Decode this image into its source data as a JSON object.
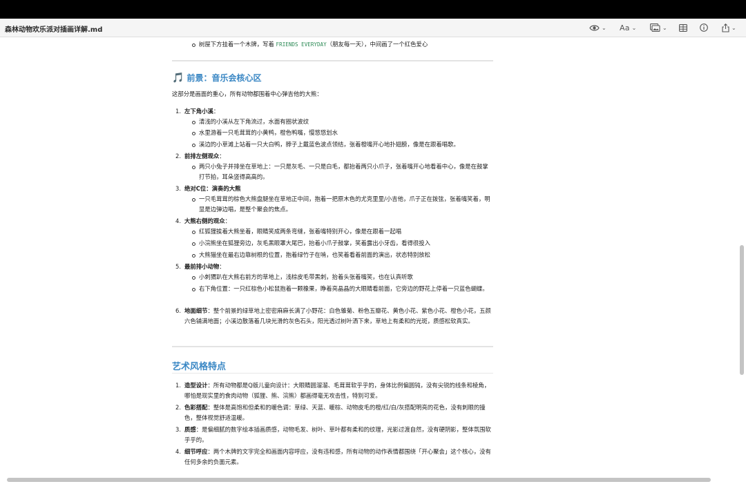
{
  "window": {
    "title": "森林动物欢乐派对插画详解.md",
    "toolbar": {
      "font_label": "Aa"
    }
  },
  "intro_bullet": {
    "pre": "树屋下方挂着一个木牌，写着 ",
    "code": "FRIENDS EVERYDAY",
    "post": "（朋友每一天），中间画了一个红色爱心"
  },
  "foreground": {
    "icon": "🎵",
    "heading": "前景：音乐会核心区",
    "intro": "这部分是画面的重心，所有动物都围着中心弹吉他的大熊：",
    "items": [
      {
        "n": "1.",
        "title": "左下角小溪",
        "colon": "：",
        "subs": [
          "清浅的小溪从左下角流过，水面有圈状波纹",
          "水里游着一只毛茸茸的小黄鸭，橙色鸭嘴，慢悠悠划水",
          "溪边的小草滩上站着一只大白鸭，脖子上戴蓝色波点领结，张着橙嘴开心地扑翅膀，像是在跟着唱歌。"
        ]
      },
      {
        "n": "2.",
        "title": "前排左侧观众",
        "colon": "：",
        "subs": [
          "两只小兔子并排坐在草地上：一只是灰毛、一只是白毛，都抬着两只小爪子，张着嘴开心地看着中心，像是在鼓掌打节拍，耳朵竖得高高的。"
        ]
      },
      {
        "n": "3.",
        "title": "绝对C位：演奏的大熊",
        "colon": "",
        "subs": [
          "一只毛茸茸的棕色大熊盘腿坐在草地正中间，抱着一把原木色的尤克里里/小吉他，爪子正在拨弦，张着嘴笑着，明显是边弹边唱，是整个聚会的焦点。"
        ]
      },
      {
        "n": "4.",
        "title": "大熊右侧的观众",
        "colon": "：",
        "subs": [
          "红狐狸挨着大熊坐着，眼睛笑成两条弯缝，张着嘴特别开心，像是在跟着一起唱",
          "小浣熊坐在狐狸旁边，灰毛黑眼罩大尾巴，抬着小爪子鼓掌，笑着露出小牙齿，看得很投入",
          "大熊猫坐在最右边靠树根的位置，抱着绿竹子在啃，也笑着看着前面的演出，状态特别放松"
        ]
      },
      {
        "n": "5.",
        "title": "最前排小动物",
        "colon": "：",
        "subs": [
          "小刺猬趴在大熊右前方的草地上，浅棕皮毛带黑刺，抬着头张着嘴笑，也在认真听歌",
          "右下角位置：一只红棕色小松鼠抱着一颗橡果，睁着亮晶晶的大眼睛看前面，它旁边的野花上停着一只蓝色蝴蝶。"
        ]
      },
      {
        "n": "6.",
        "title": "地面细节",
        "colon": "",
        "text": "：整个前景的绿草地上密密麻麻长满了小野花：白色雏菊、粉色五瓣花、黄色小花、紫色小花、橙色小花，五颜六色铺满地面；小溪边散落着几块光滑的灰色石头，阳光透过树叶洒下来，草地上有柔和的光斑，质感松软真实。"
      }
    ]
  },
  "art_style": {
    "heading": "艺术风格特点",
    "items": [
      {
        "n": "1.",
        "title": "造型设计",
        "text": "：所有动物都是Q版儿童向设计：大眼睛圆溜溜、毛茸茸软乎乎的，身体比例偏圆钝，没有尖锐的线条和棱角，哪怕是现实里的食肉动物（狐狸、熊、浣熊）都画得毫无攻击性，特别可爱。"
      },
      {
        "n": "2.",
        "title": "色彩搭配",
        "text": "：整体是高饱和但柔和的暖色调：草绿、天蓝、暖棕、动物皮毛的橙/红/白/灰搭配明亮的花色，没有刺眼的撞色，整体视觉舒适温暖。"
      },
      {
        "n": "3.",
        "title": "质感",
        "text": "：是偏细腻的数字绘本插画质感，动物毛发、树叶、草叶都有柔和的纹理，光影过渡自然，没有硬阴影，整体氛围软乎乎的。"
      },
      {
        "n": "4.",
        "title": "细节呼应",
        "text": "：两个木牌的文字完全和画面内容呼应，没有违和感，所有动物的动作表情都围绕「开心聚会」这个核心，没有任何多余的负面元素。"
      }
    ]
  }
}
